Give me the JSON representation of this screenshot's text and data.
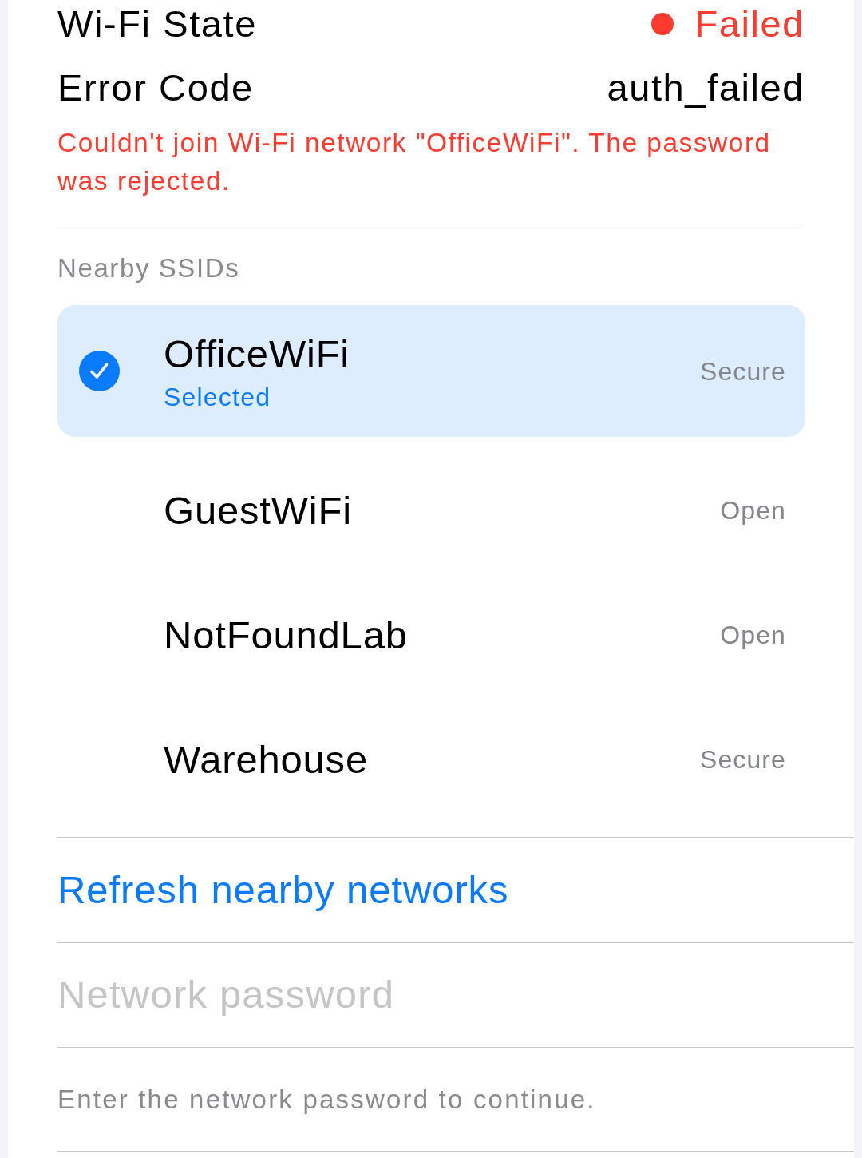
{
  "status_rows": [
    {
      "kind": "status",
      "label": "Wi-Fi State",
      "value": "Failed",
      "color": "#ff3b30"
    },
    {
      "kind": "text",
      "label": "Error Code",
      "value": "auth_failed"
    }
  ],
  "error_message": "Couldn't join Wi-Fi network \"OfficeWiFi\". The password was rejected.",
  "nearby": {
    "title": "Nearby SSIDs",
    "networks": [
      {
        "name": "OfficeWiFi",
        "subtitle": "Selected",
        "security": "Secure",
        "selected": true
      },
      {
        "name": "GuestWiFi",
        "security": "Open",
        "selected": false
      },
      {
        "name": "NotFoundLab",
        "security": "Open",
        "selected": false
      },
      {
        "name": "Warehouse",
        "security": "Secure",
        "selected": false
      }
    ]
  },
  "refresh_link": "Refresh nearby networks",
  "password_field": {
    "placeholder": "Network password"
  },
  "footer_note": "Enter the network password to continue."
}
